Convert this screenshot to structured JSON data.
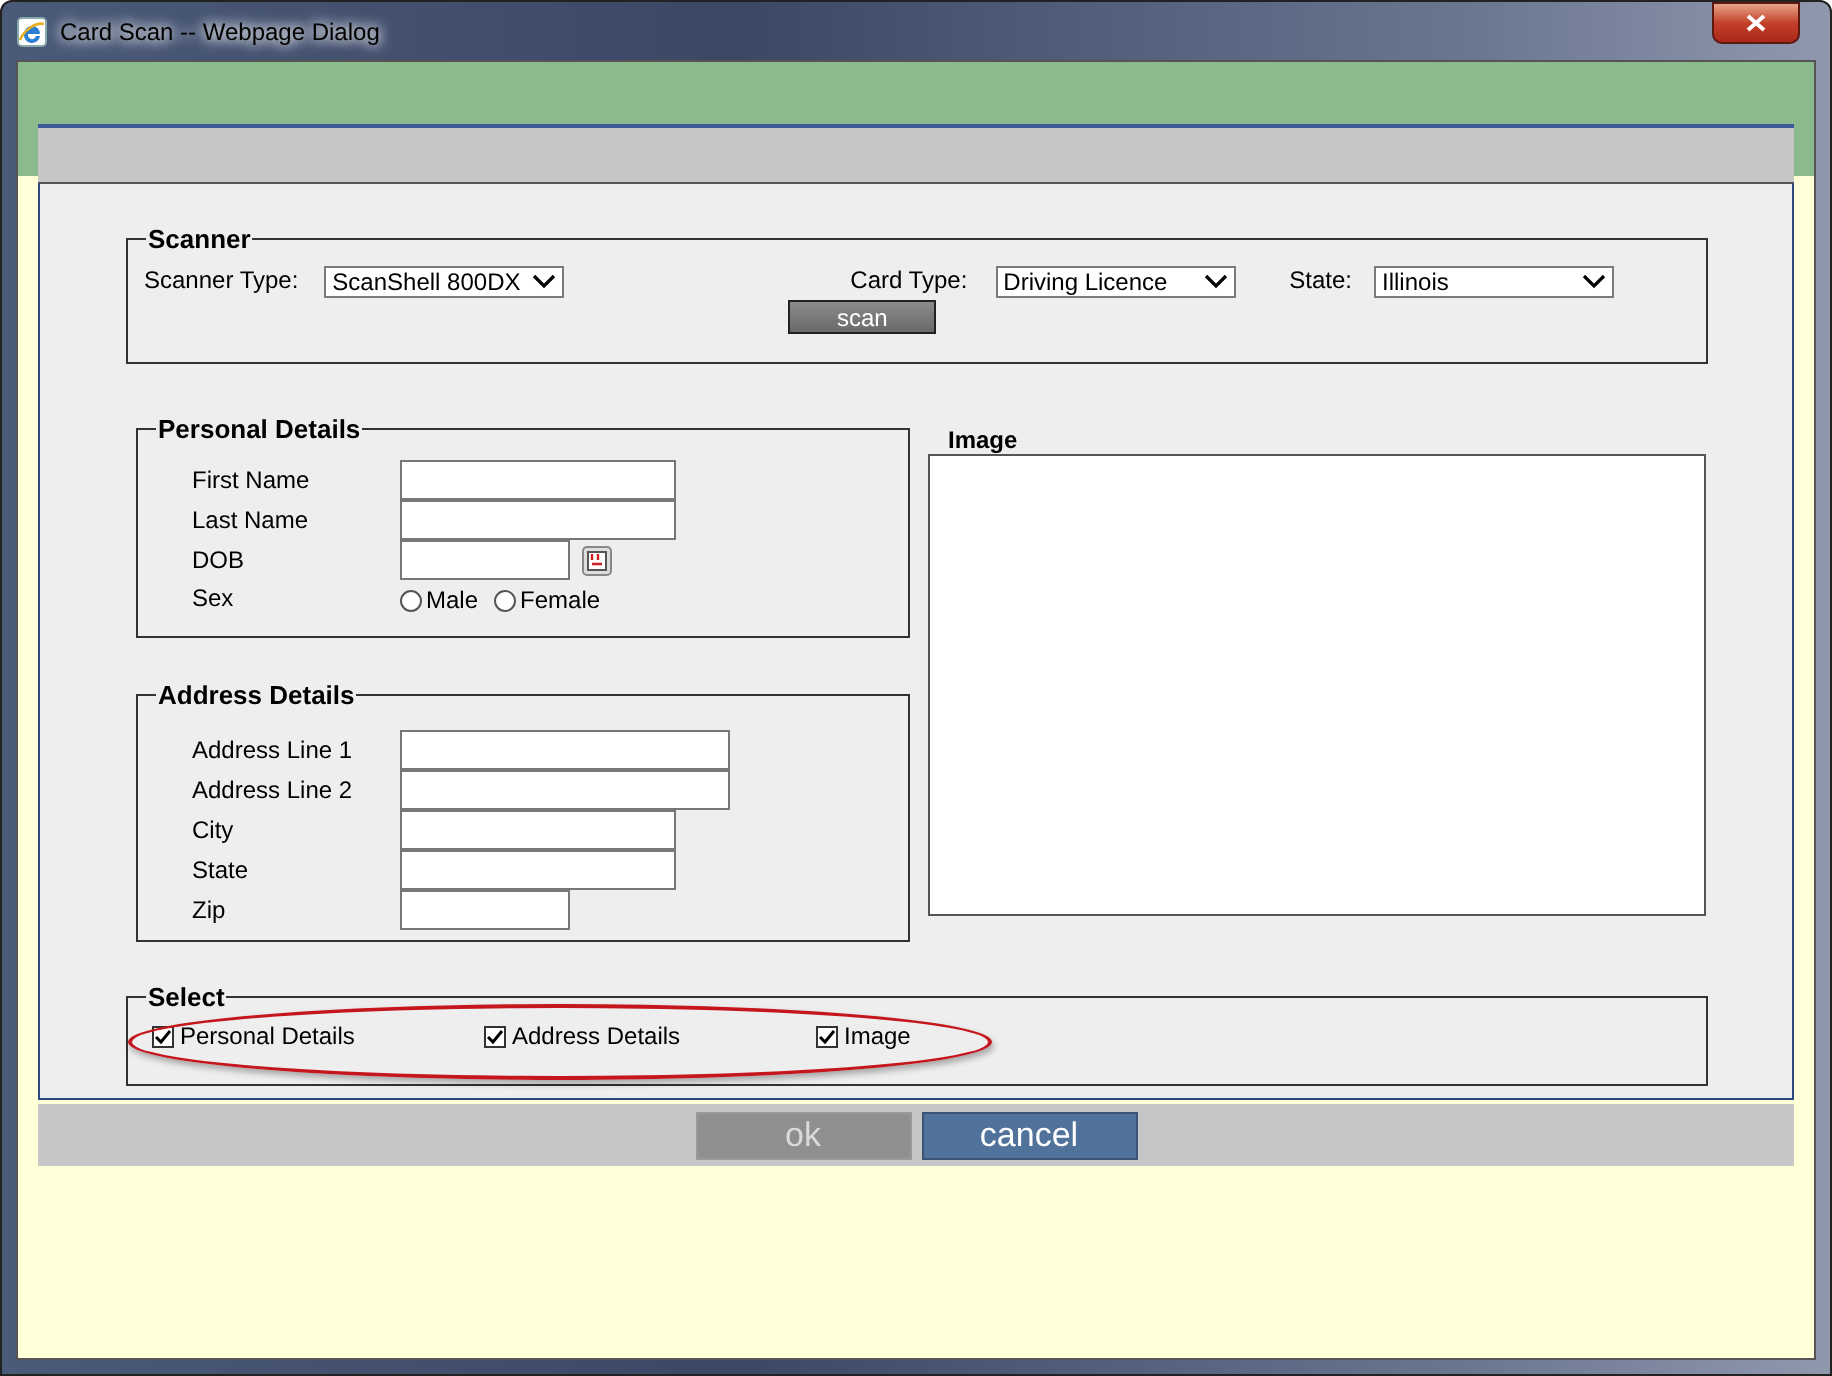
{
  "window": {
    "title": "Card Scan -- Webpage Dialog"
  },
  "scanner": {
    "legend": "Scanner",
    "selects": [
      {
        "label": "Scanner Type:",
        "value": "ScanShell 800DX"
      },
      {
        "label": "Card Type:",
        "value": "Driving Licence"
      },
      {
        "label": "State:",
        "value": "Illinois"
      }
    ],
    "scan_button": "scan"
  },
  "personal": {
    "legend": "Personal Details",
    "fields": [
      {
        "label": "First Name",
        "kind": "text"
      },
      {
        "label": "Last Name",
        "kind": "text"
      },
      {
        "label": "DOB",
        "kind": "date"
      }
    ],
    "sex": {
      "label": "Sex",
      "options": [
        {
          "label": "Male",
          "selected": false
        },
        {
          "label": "Female",
          "selected": false
        }
      ]
    }
  },
  "image": {
    "label": "Image"
  },
  "address": {
    "legend": "Address Details",
    "fields": [
      {
        "label": "Address Line 1"
      },
      {
        "label": "Address Line 2"
      },
      {
        "label": "City"
      },
      {
        "label": "State"
      },
      {
        "label": "Zip"
      }
    ]
  },
  "select": {
    "legend": "Select",
    "highlighted": true,
    "options": [
      {
        "label": "Personal Details",
        "checked": true
      },
      {
        "label": "Address Details",
        "checked": true
      },
      {
        "label": "Image",
        "checked": true
      }
    ]
  },
  "buttons": [
    {
      "label": "ok",
      "disabled": true
    },
    {
      "label": "cancel",
      "disabled": false
    }
  ]
}
